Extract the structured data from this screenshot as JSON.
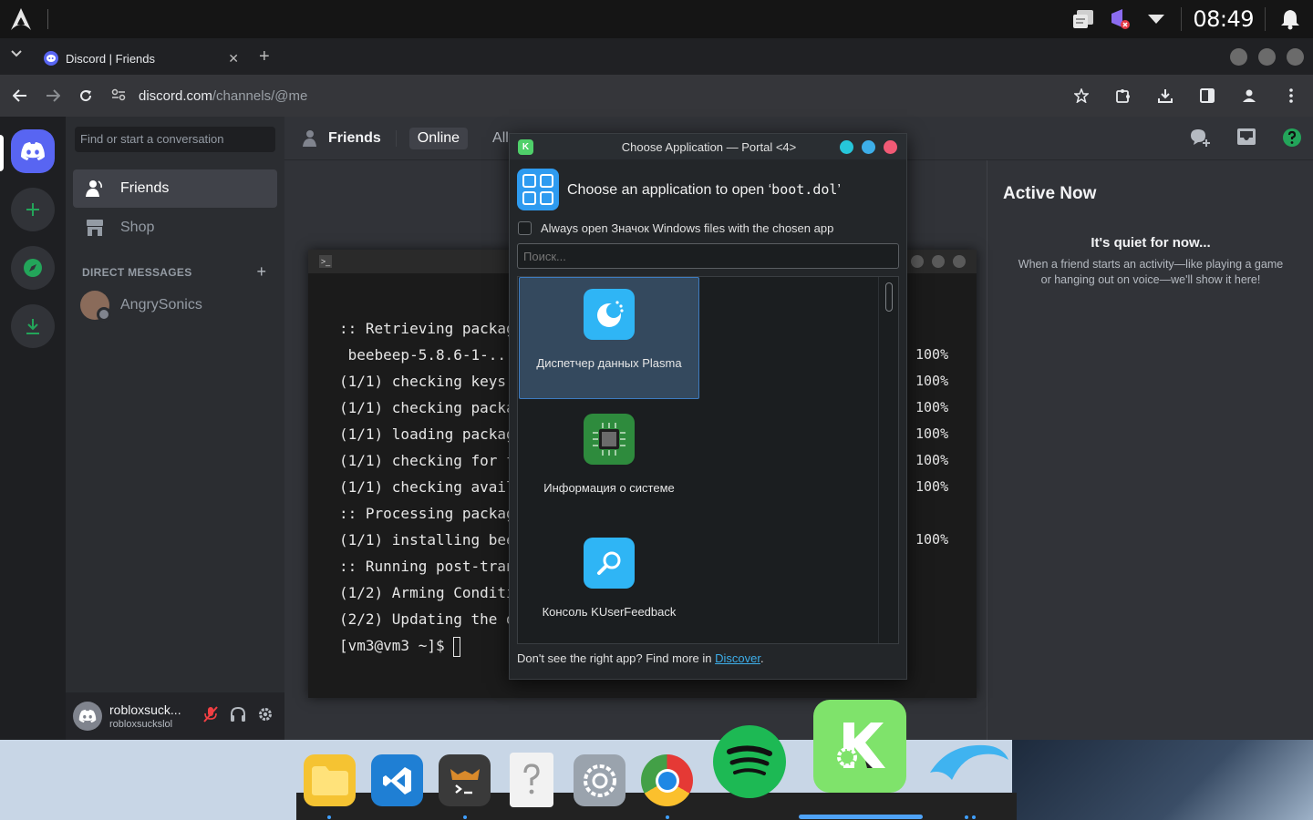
{
  "system_panel": {
    "clock": "08:49"
  },
  "browser": {
    "tab_title": "Discord | Friends",
    "url_host": "discord.com",
    "url_path": "/channels/@me"
  },
  "discord": {
    "search_placeholder": "Find or start a conversation",
    "nav": {
      "friends": "Friends",
      "shop": "Shop"
    },
    "dm_header": "DIRECT MESSAGES",
    "dm_items": [
      {
        "name": "AngrySonics"
      }
    ],
    "user": {
      "display_name": "robloxsuck...",
      "username": "robloxsuckslol"
    },
    "header": {
      "title": "Friends",
      "tabs": [
        "Online",
        "All"
      ]
    },
    "active_now": {
      "title": "Active Now",
      "quiet_title": "It's quiet for now...",
      "quiet_desc": "When a friend starts an activity—like playing a game or hanging out on voice—we'll show it here!"
    }
  },
  "terminal": {
    "lines": [
      ":: Retrieving packages...",
      " beebeep-5.8.6-1-...",
      "(1/1) checking keys in k",
      "(1/1) checking package i",
      "(1/1) loading package fi",
      "(1/1) checking for file",
      "(1/1) checking availabl",
      ":: Processing package ch",
      "(1/1) installing beebeep",
      ":: Running post-transact",
      "(1/2) Arming ConditionNe",
      "(2/2) Updating the deskt"
    ],
    "prompt": "[vm3@vm3 ~]$ ",
    "percent_lines": [
      "100%",
      "100%",
      "100%",
      "100%",
      "100%",
      "100%",
      "",
      "100%"
    ]
  },
  "dialog": {
    "title": "Choose Application — Portal <4>",
    "heading_prefix": "Choose an application to open ‘",
    "heading_file": "boot.dol",
    "heading_suffix": "’",
    "always_open_label": "Always open Значок Windows files with the chosen app",
    "search_placeholder": "Поиск...",
    "apps": [
      {
        "name": "Диспетчер данных Plasma"
      },
      {
        "name": "Информация о системе"
      },
      {
        "name": "Консоль KUserFeedback"
      }
    ],
    "footer_text": "Don't see the right app? Find more in ",
    "footer_link": "Discover",
    "footer_end": "."
  },
  "colors": {
    "discord_blurple": "#5865f2",
    "discord_green": "#23a55a",
    "kde_blue": "#3daee9"
  }
}
